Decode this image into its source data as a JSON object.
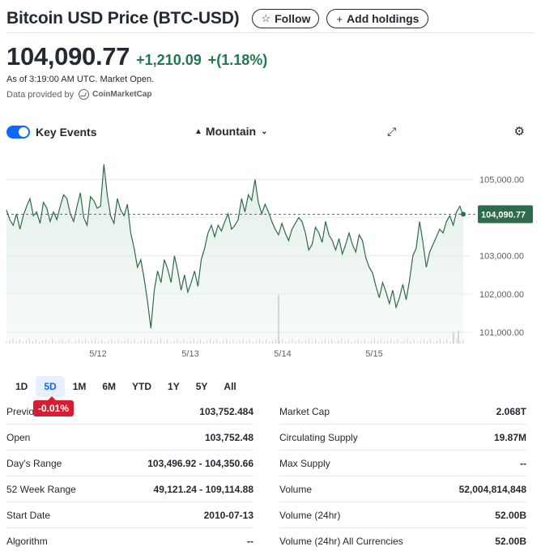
{
  "header": {
    "title": "Bitcoin USD Price (BTC-USD)",
    "follow_label": "Follow",
    "follow_icon": "star-icon",
    "holdings_label": "Add holdings",
    "holdings_icon": "plus-icon"
  },
  "quote": {
    "price": "104,090.77",
    "change": "+1,210.09",
    "change_pct": "+(1.18%)",
    "as_of": "As of 3:19:00 AM UTC. Market Open.",
    "provided_by": "Data provided by",
    "provider": "CoinMarketCap"
  },
  "toolbar": {
    "key_events_label": "Key Events",
    "key_events_on": true,
    "chart_type_label": "Mountain",
    "expand_icon": "expand-icon",
    "settings_icon": "gear-icon"
  },
  "chart_data": {
    "type": "area",
    "x_ticks": [
      "5/12",
      "5/13",
      "5/14",
      "5/15"
    ],
    "y_ticks": [
      "105,000.00",
      "104,000.00",
      "103,000.00",
      "102,000.00",
      "101,000.00"
    ],
    "ylim": [
      100700,
      105500
    ],
    "current_price_label": "104,090.77",
    "current_price": 104090.77,
    "previous_close": 104090.77,
    "line_color": "#2e6b4a",
    "fill_color": "#e3efe8",
    "values": [
      104200,
      103950,
      103800,
      104100,
      103700,
      104050,
      104300,
      104500,
      104050,
      104150,
      103850,
      104400,
      104250,
      103900,
      104150,
      103950,
      104300,
      104600,
      104500,
      104100,
      103900,
      104300,
      104650,
      104000,
      103800,
      104550,
      104450,
      104250,
      104300,
      105400,
      104600,
      104050,
      103850,
      104500,
      104200,
      104050,
      104350,
      103600,
      103200,
      102700,
      102900,
      102400,
      101800,
      101100,
      102100,
      102600,
      102300,
      102900,
      102650,
      102300,
      103000,
      102600,
      102100,
      102500,
      102050,
      102300,
      102600,
      102200,
      102900,
      103200,
      103600,
      103800,
      103500,
      103800,
      103650,
      103900,
      104100,
      103700,
      103800,
      103950,
      104500,
      104150,
      104600,
      104450,
      105000,
      104400,
      104100,
      104350,
      104150,
      103900,
      103700,
      103550,
      103850,
      103600,
      103400,
      103700,
      103850,
      104000,
      103900,
      103600,
      103150,
      103300,
      103750,
      103600,
      103350,
      103900,
      103550,
      103400,
      103150,
      103450,
      103050,
      103300,
      103600,
      103300,
      103100,
      103550,
      103400,
      102950,
      102700,
      102550,
      102200,
      101900,
      102300,
      102050,
      101750,
      102100,
      101650,
      101900,
      102250,
      101850,
      102350,
      103000,
      103200,
      103900,
      103350,
      102700,
      103100,
      103300,
      103500,
      103700,
      103600,
      103900,
      104050,
      103800,
      104150,
      104300,
      104050
    ]
  },
  "ranges": {
    "tabs": [
      "1D",
      "5D",
      "1M",
      "6M",
      "YTD",
      "1Y",
      "5Y",
      "All"
    ],
    "active": "5D",
    "tooltip": "-0.01%"
  },
  "stats": {
    "left": [
      {
        "label": "Previous Close",
        "value": "103,752.484"
      },
      {
        "label": "Open",
        "value": "103,752.48"
      },
      {
        "label": "Day's Range",
        "value": "103,496.92 - 104,350.66"
      },
      {
        "label": "52 Week Range",
        "value": "49,121.24 - 109,114.88"
      },
      {
        "label": "Start Date",
        "value": "2010-07-13"
      },
      {
        "label": "Algorithm",
        "value": "--"
      }
    ],
    "right": [
      {
        "label": "Market Cap",
        "value": "2.068T"
      },
      {
        "label": "Circulating Supply",
        "value": "19.87M"
      },
      {
        "label": "Max Supply",
        "value": "--"
      },
      {
        "label": "Volume",
        "value": "52,004,814,848"
      },
      {
        "label": "Volume (24hr)",
        "value": "52.00B"
      },
      {
        "label": "Volume (24hr) All Currencies",
        "value": "52.00B"
      }
    ]
  }
}
